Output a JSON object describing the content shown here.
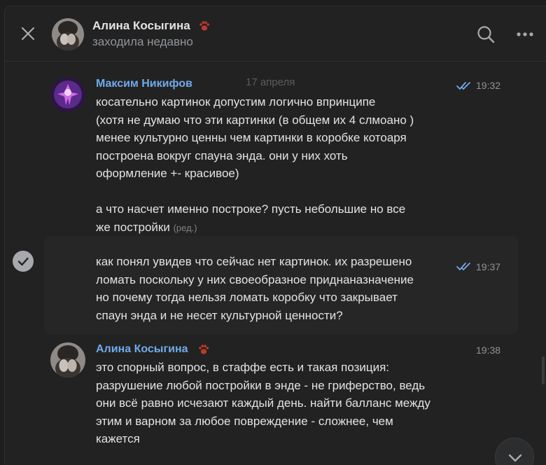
{
  "header": {
    "title": "Алина Косыгина",
    "status": "заходила недавно"
  },
  "date_separator": "17 апреля",
  "messages": [
    {
      "author": "Максим Никифов",
      "time": "19:32",
      "read": true,
      "text": "косательно картинок допустим логично впринципе\n(хотя не думаю что эти картинки (в общем их 4 слмоано )\nменее культурно ценны чем картинки в коробке котоаря\nпостроена вокруг спауна энда. они у них хоть\nоформление +- красивое)",
      "text2": "а что насчет именно построке? пусть небольшие но все\nже постройки",
      "edited_label": "(ред.)"
    },
    {
      "time": "19:37",
      "read": true,
      "text": "как понял увидев что сейчас нет картинок. их разрешено\nломать поскольку у них своеобразное приднаназначение\nно почему тогда нельзя ломать коробку что закрывает\nспаун энда и не несет культурной ценности?"
    },
    {
      "author": "Алина Косыгина",
      "time": "19:38",
      "text": "это спорный вопрос, в стаффе есть и такая позиция:\nразрушение любой постройки в энде - не гриферство, ведь\nони всё равно исчезают каждый день. найти балланс между\nэтим и варном за любое повреждение - сложнее, чем\nкажется"
    }
  ],
  "colors": {
    "background": "#222222",
    "author_name": "#71aaeb",
    "text": "#e1e3e6",
    "muted": "#909499",
    "read_checks": "#71aaeb"
  },
  "icons": [
    "close-icon",
    "search-icon",
    "more-icon",
    "paw-emoji-icon",
    "double-check-icon",
    "select-check-icon",
    "chevron-down-icon"
  ]
}
